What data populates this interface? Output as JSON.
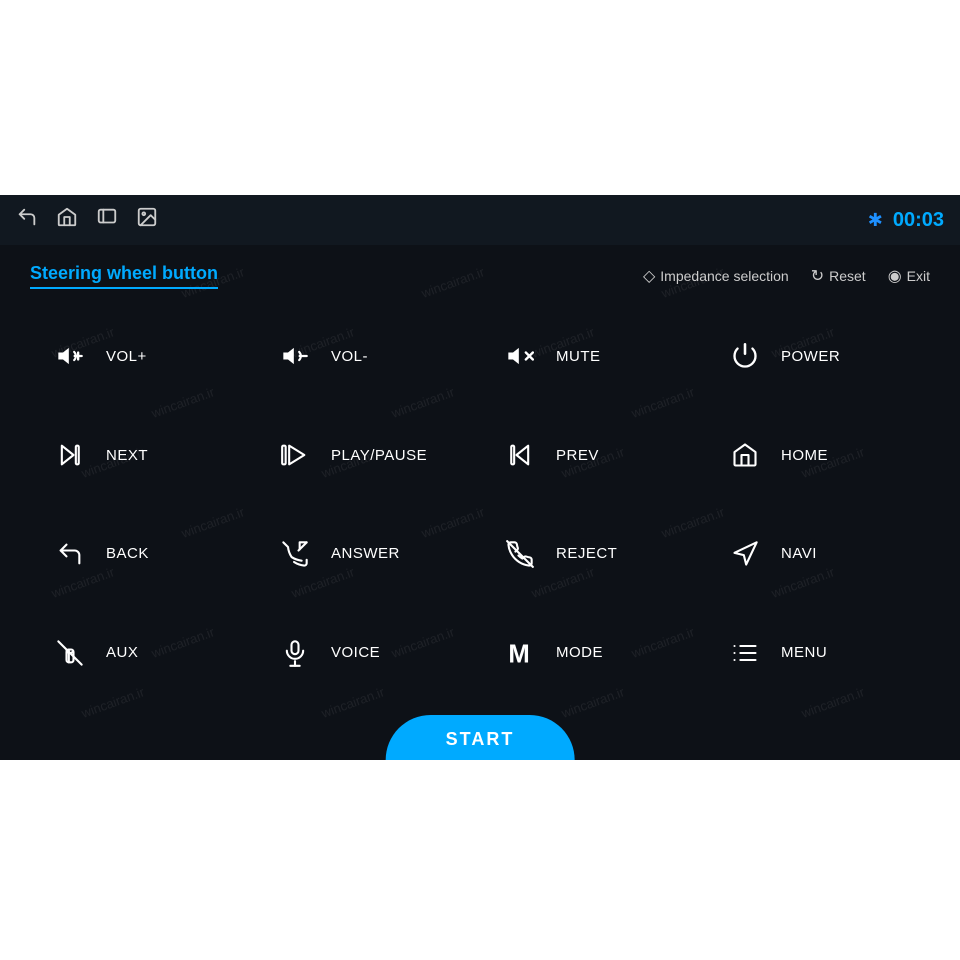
{
  "topBar": {
    "clock": "00:03",
    "icons": [
      "back-icon",
      "home-icon",
      "windows-icon",
      "image-icon",
      "bluetooth-icon"
    ]
  },
  "header": {
    "title": "Steering wheel button",
    "actions": [
      {
        "icon": "shield-icon",
        "label": "Impedance selection"
      },
      {
        "icon": "reset-icon",
        "label": "Reset"
      },
      {
        "icon": "exit-icon",
        "label": "Exit"
      }
    ]
  },
  "buttons": [
    {
      "id": "vol-plus",
      "icon": "vol-plus",
      "label": "VOL+"
    },
    {
      "id": "vol-minus",
      "icon": "vol-minus",
      "label": "VOL-"
    },
    {
      "id": "mute",
      "icon": "mute",
      "label": "MUTE"
    },
    {
      "id": "power",
      "icon": "power",
      "label": "POWER"
    },
    {
      "id": "next",
      "icon": "next",
      "label": "NEXT"
    },
    {
      "id": "play-pause",
      "icon": "play-pause",
      "label": "PLAY/PAUSE"
    },
    {
      "id": "prev",
      "icon": "prev",
      "label": "PREV"
    },
    {
      "id": "home",
      "icon": "home",
      "label": "HOME"
    },
    {
      "id": "back",
      "icon": "back",
      "label": "BACK"
    },
    {
      "id": "answer",
      "icon": "answer",
      "label": "ANSWER"
    },
    {
      "id": "reject",
      "icon": "reject",
      "label": "REJECT"
    },
    {
      "id": "navi",
      "icon": "navi",
      "label": "NAVI"
    },
    {
      "id": "aux",
      "icon": "aux",
      "label": "AUX"
    },
    {
      "id": "voice",
      "icon": "voice",
      "label": "VOICE"
    },
    {
      "id": "mode",
      "icon": "mode",
      "label": "MODE"
    },
    {
      "id": "menu",
      "icon": "menu",
      "label": "MENU"
    }
  ],
  "startButton": {
    "label": "START"
  },
  "watermarkText": "wincairan.ir"
}
